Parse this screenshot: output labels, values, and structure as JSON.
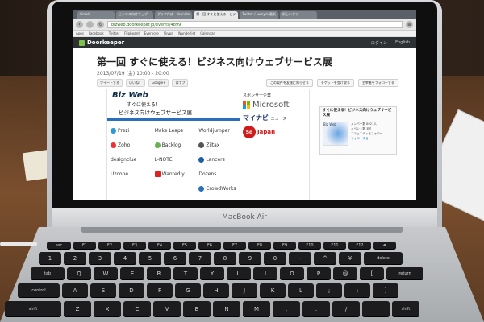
{
  "browser": {
    "tabs": [
      "Gmail",
      "ビジネス向けウェブ",
      "グラフ作成 - Keynote",
      "第一回 すぐに使える！ビジ",
      "Twitter / Lumyre 最新",
      "新しいタブ"
    ],
    "active_tab_index": 3,
    "url": "bizweb.doorkeeper.jp/events/4899",
    "bookmarks": [
      "Apps",
      "Facebook",
      "Twitter",
      "Flipboard",
      "Evernote",
      "Skype",
      "Wunderlist",
      "Calendar"
    ]
  },
  "site": {
    "logo": "Doorkeeper",
    "nav": [
      "ログイン",
      "English"
    ]
  },
  "event": {
    "title": "第一回 すぐに使える！ビジネス向けウェブサービス展",
    "date": "2013/07/19 (金) 10:00 - 20:00",
    "social": [
      "ツイートする",
      "いいね！",
      "Google+",
      "はてブ"
    ],
    "actions": [
      "この案件を友達に知らせる",
      "チケットを受け取る",
      "主宰者をフォローする"
    ]
  },
  "banner": {
    "title": "Biz Web",
    "subtitle_line1": "すぐに使える！",
    "subtitle_line2": "ビジネス向けウェブサービス展",
    "logos": [
      "Prezi",
      "Make Leaps",
      "Worldjumper",
      "Zoho",
      "Backlog",
      "Ziltax",
      "designclue",
      "L-NOTE",
      "Lancers",
      "Uzcope",
      "Wantedly",
      "Dozens",
      "",
      "",
      "CrowdWorks"
    ],
    "sponsor_label": "スポンサー企業",
    "sponsors": {
      "microsoft": "Microsoft",
      "mynavi": "マイナビ",
      "mynavi_sub": "ニュース",
      "sd": "Sd",
      "sd_text": "Japan"
    }
  },
  "sidebar_box": {
    "title": "すぐに使える！ビジネス向けウェブサービス展",
    "pic_label": "Biz Web",
    "stats": [
      "メンバー数 8921人",
      "イベント数 3回",
      "コミュニティをフォロー",
      "フォローする"
    ]
  },
  "laptop": {
    "brand": "MacBook Air"
  },
  "keyboard": {
    "row1": [
      "esc",
      "F1",
      "F2",
      "F3",
      "F4",
      "F5",
      "F6",
      "F7",
      "F8",
      "F9",
      "F10",
      "F11",
      "F12",
      "⏏"
    ],
    "row2": [
      "1",
      "2",
      "3",
      "4",
      "5",
      "6",
      "7",
      "8",
      "9",
      "0",
      "-",
      "^",
      "¥",
      "delete"
    ],
    "row3": [
      "tab",
      "Q",
      "W",
      "E",
      "R",
      "T",
      "Y",
      "U",
      "I",
      "O",
      "P",
      "@",
      "[",
      "return"
    ],
    "row4": [
      "control",
      "A",
      "S",
      "D",
      "F",
      "G",
      "H",
      "J",
      "K",
      "L",
      ";",
      ":",
      "]"
    ],
    "row5": [
      "shift",
      "Z",
      "X",
      "C",
      "V",
      "B",
      "N",
      "M",
      ",",
      ".",
      "/",
      "_",
      "shift"
    ]
  },
  "colors": {
    "doorkeeper_bar": "#2d3134",
    "bizweb_blue": "#2a70b8",
    "sd_red": "#d01b1b"
  }
}
